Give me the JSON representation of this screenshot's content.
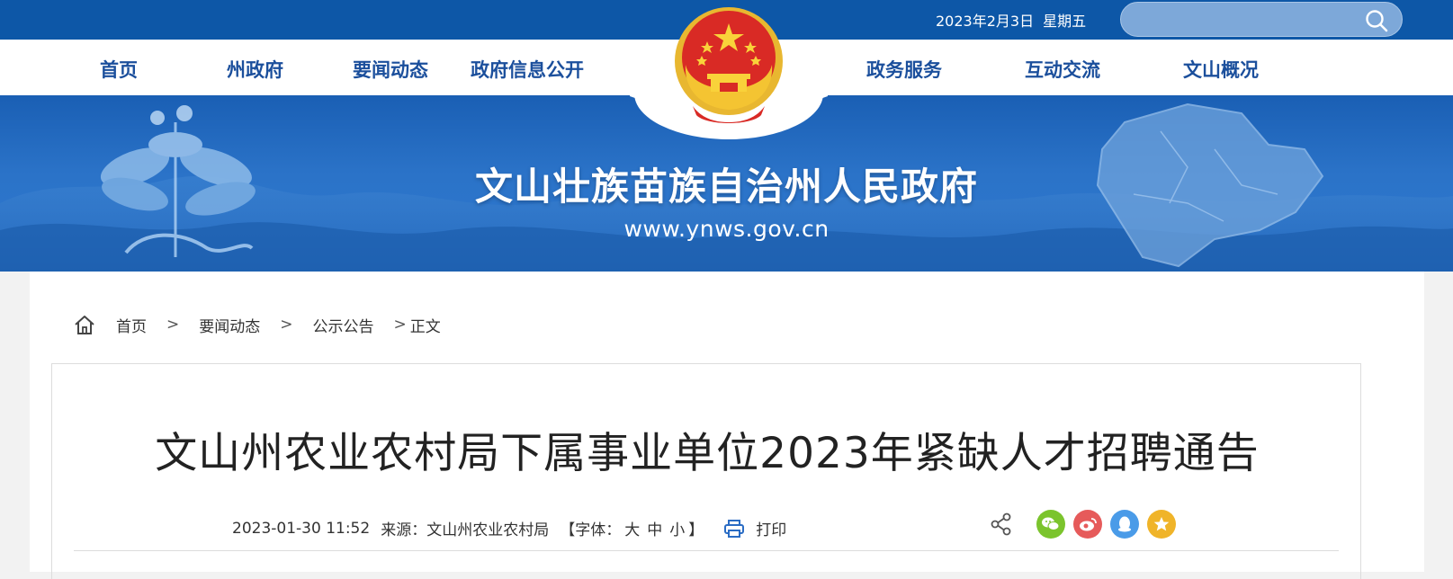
{
  "header": {
    "date": "2023年2月3日",
    "weekday": "星期五",
    "search_placeholder": ""
  },
  "nav": {
    "left": [
      "首页",
      "州政府",
      "要闻动态",
      "政府信息公开"
    ],
    "right": [
      "政务服务",
      "互动交流",
      "文山概况"
    ]
  },
  "banner": {
    "title": "文山壮族苗族自治州人民政府",
    "url": "www.ynws.gov.cn"
  },
  "breadcrumb": {
    "items": [
      "首页",
      "要闻动态",
      "公示公告",
      "正文"
    ],
    "separator": ">"
  },
  "article": {
    "title": "文山州农业农村局下属事业单位2023年紧缺人才招聘通告",
    "datetime": "2023-01-30 11:52",
    "source_label": "来源：",
    "source": "文山州农业农村局",
    "font_label_open": "【字体：",
    "font_large": "大",
    "font_medium": "中",
    "font_small": "小",
    "font_label_close": "】",
    "print_label": "打印"
  },
  "share": {
    "icons": [
      {
        "name": "wechat-icon",
        "color": "#7bc42d"
      },
      {
        "name": "weibo-icon",
        "color": "#e65a5a"
      },
      {
        "name": "qq-icon",
        "color": "#4a9be8"
      },
      {
        "name": "favorite-icon",
        "color": "#f0b429"
      }
    ]
  },
  "colors": {
    "topbar": "#0d57a7",
    "nav_text": "#1b4f9c",
    "banner": "#2b73c8"
  }
}
